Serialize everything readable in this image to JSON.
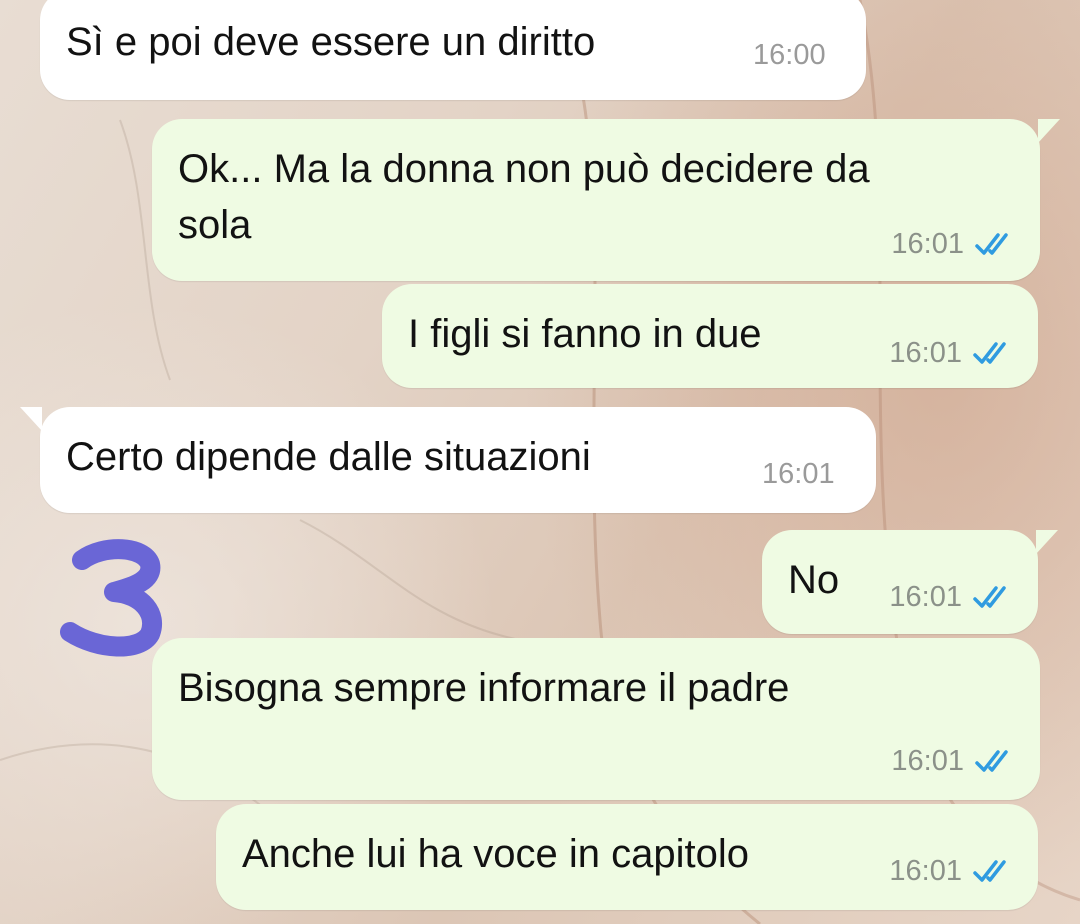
{
  "messages": [
    {
      "direction": "incoming",
      "text": "Sì e poi deve essere un diritto",
      "time": "16:00"
    },
    {
      "direction": "outgoing",
      "text": "Ok... Ma la donna non può decidere da\nsola",
      "time": "16:01",
      "status": "read"
    },
    {
      "direction": "outgoing",
      "text": "I figli si fanno in due",
      "time": "16:01",
      "status": "read"
    },
    {
      "direction": "incoming",
      "text": "Certo dipende dalle situazioni",
      "time": "16:01"
    },
    {
      "direction": "outgoing",
      "text": "No",
      "time": "16:01",
      "status": "read"
    },
    {
      "direction": "outgoing",
      "text": "Bisogna sempre informare il padre",
      "time": "16:01",
      "status": "read"
    },
    {
      "direction": "outgoing",
      "text": "Anche lui ha voce in capitolo",
      "time": "16:01",
      "status": "read"
    }
  ],
  "colors": {
    "incoming_bubble": "#ffffff",
    "outgoing_bubble": "#effbe3",
    "read_tick": "#2f9be0",
    "scribble": "#6a66d6"
  },
  "icons": {
    "read_receipt": "double-check-icon",
    "annotation": "scribble-mark"
  }
}
